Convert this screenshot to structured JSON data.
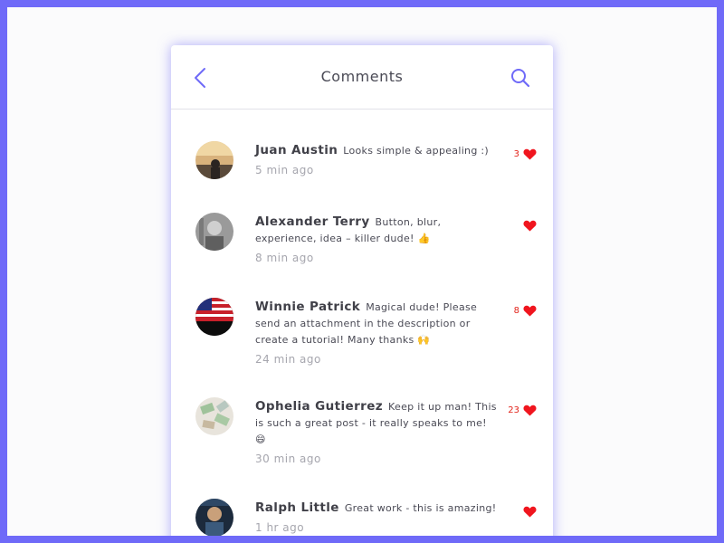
{
  "header": {
    "title": "Comments",
    "back_icon": "chevron-left-icon",
    "search_icon": "search-icon"
  },
  "colors": {
    "accent": "#6f6af8",
    "like": "#f0151e",
    "text": "#4a4a55",
    "muted": "#a6a6ae"
  },
  "comments": [
    {
      "name": "Juan Austin",
      "text": "Looks simple & appealing :)",
      "time": "5 min ago",
      "likes": "3"
    },
    {
      "name": "Alexander Terry",
      "text": "Button, blur, experience, idea – killer dude! 👍",
      "time": "8 min ago",
      "likes": ""
    },
    {
      "name": "Winnie Patrick",
      "text": "Magical dude! Please send an attachment in the description or create a tutorial! Many thanks 🙌",
      "time": "24 min ago",
      "likes": "8"
    },
    {
      "name": "Ophelia Gutierrez",
      "text": "Keep it up man! This is such a great post - it really speaks to me! 😄",
      "time": "30 min ago",
      "likes": "23"
    },
    {
      "name": "Ralph Little",
      "text": "Great work - this is amazing!",
      "time": "1 hr ago",
      "likes": ""
    }
  ]
}
